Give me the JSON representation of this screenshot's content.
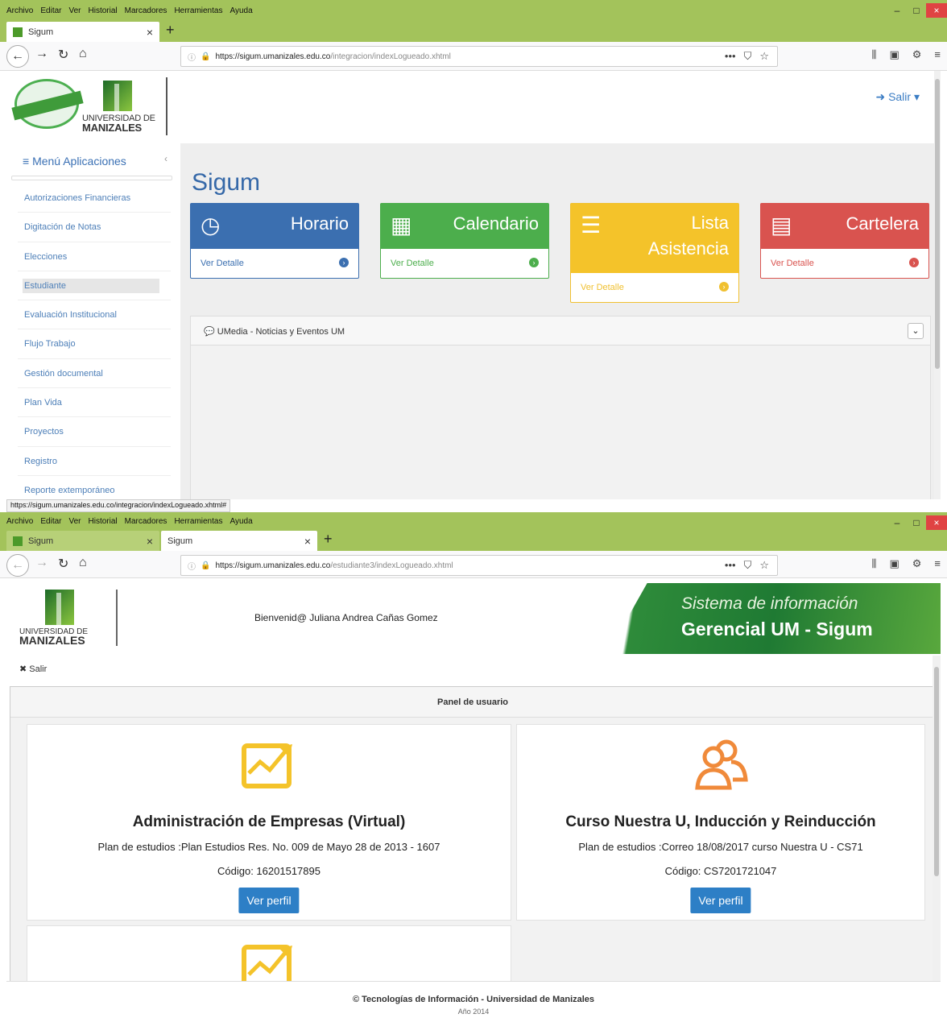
{
  "browser": {
    "menu": [
      "Archivo",
      "Editar",
      "Ver",
      "Historial",
      "Marcadores",
      "Herramientas",
      "Ayuda"
    ],
    "window_controls": [
      "–",
      "□",
      "×"
    ],
    "url_icons": [
      "•••",
      "⛉",
      "☆"
    ],
    "tool_icons": [
      "⫼",
      "▣",
      "⚙",
      "≡"
    ]
  },
  "window1": {
    "tabs": [
      {
        "label": "Sigum"
      }
    ],
    "url": {
      "host": "https://sigum.umanizales.edu.co",
      "path": "/integracion/indexLogueado.xhtml"
    },
    "logo": {
      "university_line1": "UNIVERSIDAD DE",
      "university_line2": "MANIZALES"
    },
    "salir": "Salir",
    "sidebar": {
      "title": "Menú Aplicaciones",
      "items": [
        "Autorizaciones Financieras",
        "Digitación de Notas",
        "Elecciones",
        "Estudiante",
        "Evaluación Institucional",
        "Flujo Trabajo",
        "Gestión documental",
        "Plan Vida",
        "Proyectos",
        "Registro",
        "Reporte extemporáneo"
      ],
      "active_item": "Estudiante"
    },
    "main": {
      "title": "Sigum",
      "tiles": [
        {
          "label": "Horario",
          "link": "Ver Detalle",
          "color": "#3b6fb0",
          "icon": "clock-icon"
        },
        {
          "label": "Calendario",
          "link": "Ver Detalle",
          "color": "#4cae4c",
          "icon": "calendar-icon"
        },
        {
          "label_line1": "Lista",
          "label_line2": "Asistencia",
          "link": "Ver Detalle",
          "color": "#f4c32a",
          "icon": "list-icon"
        },
        {
          "label": "Cartelera",
          "link": "Ver Detalle",
          "color": "#d9534f",
          "icon": "newspaper-icon"
        }
      ],
      "umedia_title": "UMedia - Noticias y Eventos UM"
    },
    "status_url": "https://sigum.umanizales.edu.co/integracion/indexLogueado.xhtml#"
  },
  "window2": {
    "tabs": [
      {
        "label": "Sigum"
      },
      {
        "label": "Sigum"
      }
    ],
    "url": {
      "host": "https://sigum.umanizales.edu.co",
      "path": "/estudiante3/indexLogueado.xhtml"
    },
    "logo": {
      "university_line1": "UNIVERSIDAD DE",
      "university_line2": "MANIZALES"
    },
    "welcome": "Bienvenid@ Juliana Andrea Cañas Gomez",
    "banner": {
      "line1": "Sistema de información",
      "line2": "Gerencial UM - Sigum"
    },
    "salir": "Salir",
    "panel_title": "Panel de usuario",
    "programs": [
      {
        "title": "Administración de Empresas (Virtual)",
        "plan": "Plan de estudios :Plan Estudios Res. No. 009 de Mayo 28 de 2013 - 1607",
        "code": "Código: 16201517895",
        "button": "Ver perfil",
        "icon": "growth-chart-icon"
      },
      {
        "title": "Curso Nuestra U, Inducción y Reinducción",
        "plan": "Plan de estudios :Correo 18/08/2017 curso Nuestra U - CS71",
        "code": "Código: CS7201721047",
        "button": "Ver perfil",
        "icon": "people-icon"
      }
    ],
    "footer": {
      "line1": "© Tecnologías de Información - Universidad de Manizales",
      "line2": "Año 2014"
    },
    "colors": {
      "accent": "#2d7fc6",
      "chart_icon": "#f4c32a",
      "people_icon": "#f08a3a"
    }
  }
}
